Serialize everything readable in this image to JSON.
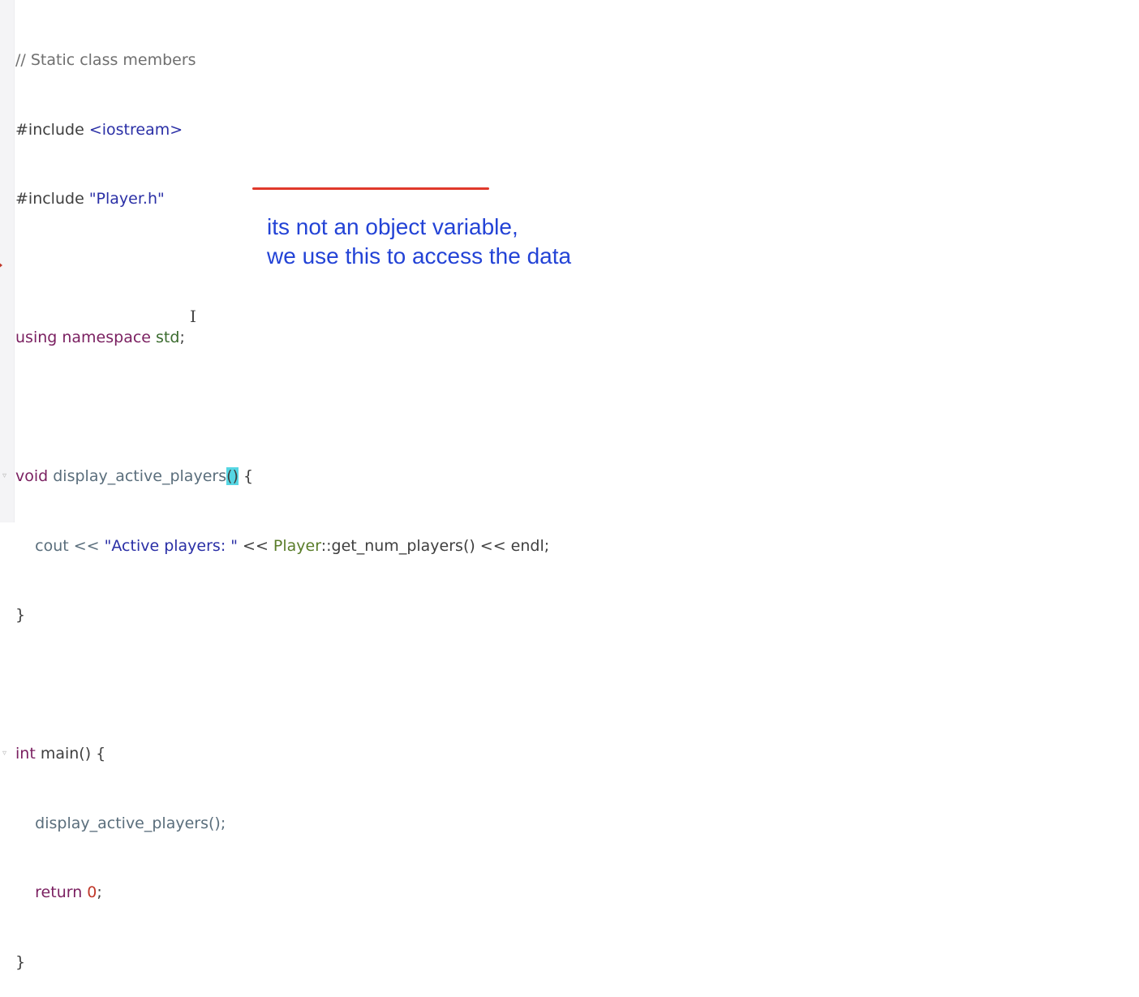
{
  "editor": {
    "lines": {
      "l1": "// Static class members",
      "l2a": "#include ",
      "l2b": "<iostream>",
      "l3a": "#include ",
      "l3b": "\"Player.h\"",
      "l5a": "using namespace ",
      "l5b": "std",
      "l5c": ";",
      "l7a": "void ",
      "l7b": "display_active_players",
      "l7c": "()",
      "l7d": " {",
      "l8a": "    cout << ",
      "l8b": "\"Active players: \"",
      "l8c": " << ",
      "l8d": "Player",
      "l8e": "::get_num_players() << endl;",
      "l9": "}",
      "l11a": "int ",
      "l11b": "main() {",
      "l12": "    display_active_players();",
      "l13a": "    return ",
      "l13b": "0",
      "l13c": ";",
      "l14": "}"
    },
    "fold_icon": "▿",
    "text_cursor": "I"
  },
  "annotation": {
    "line1": "its not an object variable,",
    "line2": "we use this to access the data",
    "underline_color": "#e0392b",
    "text_color": "#2343d6"
  }
}
